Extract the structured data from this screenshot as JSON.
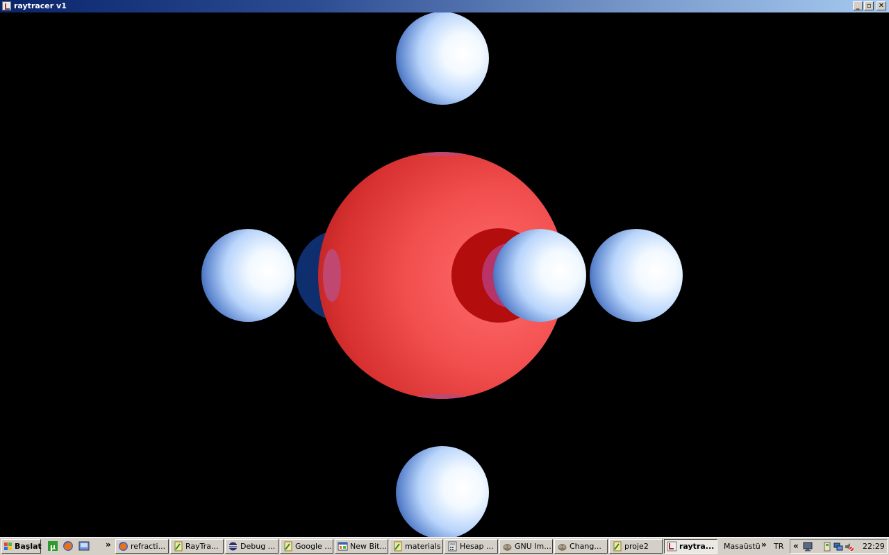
{
  "window": {
    "title": "raytracer v1",
    "controls": {
      "minimize": "_",
      "maximize": "▫",
      "close": "✕"
    }
  },
  "scene": {
    "background": "#000000",
    "central_sphere_color": "#e23a3a",
    "small_sphere_color": "#cfe6ff",
    "shadow_blue": "#0f2e6e",
    "highlight_pink": "#c04870"
  },
  "taskbar": {
    "start_label": "Başlat",
    "quicklaunch_more": "»",
    "tasks": [
      {
        "label": "refracti...",
        "icon": "firefox-icon"
      },
      {
        "label": "RayTra...",
        "icon": "java-icon"
      },
      {
        "label": "Debug ...",
        "icon": "eclipse-icon"
      },
      {
        "label": "Google ...",
        "icon": "java-icon"
      },
      {
        "label": "New Bit...",
        "icon": "window-icon"
      },
      {
        "label": "materials",
        "icon": "java-icon"
      },
      {
        "label": "Hesap ...",
        "icon": "calculator-icon"
      },
      {
        "label": "GNU Im...",
        "icon": "gimp-icon"
      },
      {
        "label": "Chang...",
        "icon": "gimp-icon"
      },
      {
        "label": "proje2",
        "icon": "java-icon"
      },
      {
        "label": "raytra...",
        "icon": "app-icon",
        "active": true
      }
    ],
    "desktop_label": "Masaüstü",
    "desktop_more": "»",
    "language": "TR",
    "tray_expand": "«",
    "clock": "22:29"
  },
  "colors": {
    "titlebar_start": "#0a246a",
    "titlebar_end": "#a6caf0",
    "taskbar": "#d4d0c8"
  }
}
